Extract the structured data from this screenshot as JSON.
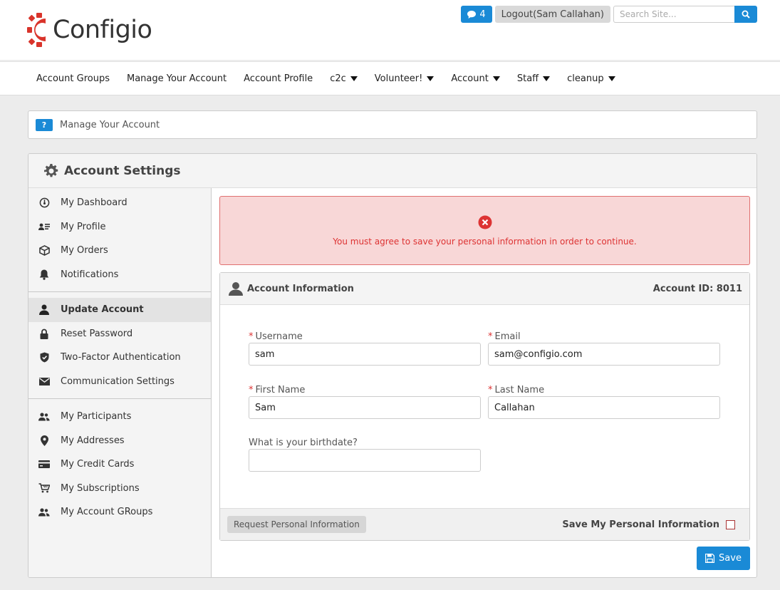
{
  "header": {
    "brand": "Configio",
    "messages_count": "4",
    "logout_label": "Logout(Sam Callahan)",
    "search_placeholder": "Search Site..."
  },
  "nav": {
    "items": [
      {
        "label": "Account Groups"
      },
      {
        "label": "Manage Your Account"
      },
      {
        "label": "Account Profile"
      },
      {
        "label": "c2c"
      },
      {
        "label": "Volunteer!"
      },
      {
        "label": "Account"
      },
      {
        "label": "Staff"
      },
      {
        "label": "cleanup"
      }
    ]
  },
  "breadcrumb": {
    "help": "?",
    "text": "Manage Your Account"
  },
  "panel": {
    "title": "Account Settings"
  },
  "sidebar": {
    "groups": [
      [
        {
          "label": "My Dashboard",
          "icon": "dashboard-icon"
        },
        {
          "label": "My Profile",
          "icon": "profile-card-icon"
        },
        {
          "label": "My Orders",
          "icon": "box-icon"
        },
        {
          "label": "Notifications",
          "icon": "bell-icon"
        }
      ],
      [
        {
          "label": "Update Account",
          "icon": "user-icon",
          "active": true
        },
        {
          "label": "Reset Password",
          "icon": "lock-icon"
        },
        {
          "label": "Two-Factor Authentication",
          "icon": "shield-icon"
        },
        {
          "label": "Communication Settings",
          "icon": "envelope-icon"
        }
      ],
      [
        {
          "label": "My Participants",
          "icon": "users-icon"
        },
        {
          "label": "My Addresses",
          "icon": "map-pin-icon"
        },
        {
          "label": "My Credit Cards",
          "icon": "credit-card-icon"
        },
        {
          "label": "My Subscriptions",
          "icon": "cart-icon"
        },
        {
          "label": "My Account GRoups",
          "icon": "users-icon"
        }
      ]
    ]
  },
  "alert": {
    "message": "You must agree to save your personal information in order to continue."
  },
  "account_info": {
    "title": "Account Information",
    "account_id": "Account ID: 8011",
    "required_mark": "*",
    "username_label": "Username",
    "username_value": "sam",
    "email_label": "Email",
    "email_value": "sam@configio.com",
    "first_name_label": "First Name",
    "first_name_value": "Sam",
    "last_name_label": "Last Name",
    "last_name_value": "Callahan",
    "birthdate_label": "What is your birthdate?",
    "birthdate_value": "",
    "request_button": "Request Personal Information",
    "save_pi_label": "Save My Personal Information",
    "save_pi_checked": false
  },
  "save_button": "Save",
  "colors": {
    "primary": "#1a8ad6",
    "danger": "#dd3333",
    "logo_red": "#d9342b"
  }
}
